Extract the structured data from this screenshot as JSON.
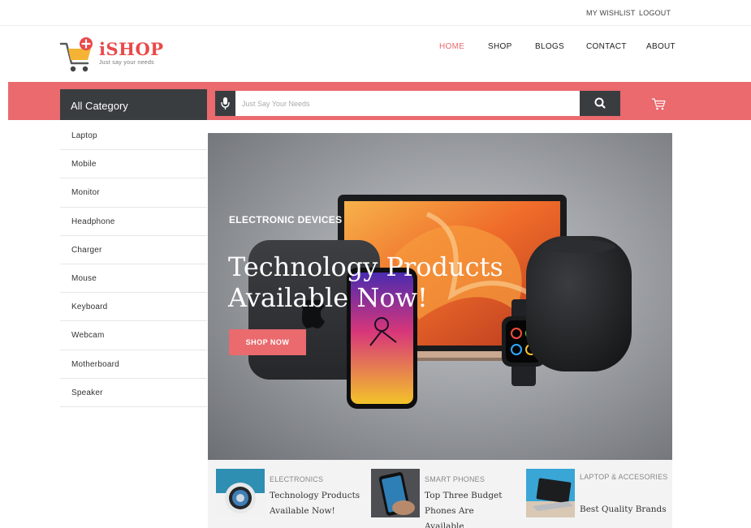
{
  "topbar": {
    "wishlist": "MY WISHLIST",
    "logout": "LOGOUT"
  },
  "brand": {
    "name": "iSHOP",
    "tagline": "Just say your needs"
  },
  "nav": {
    "items": [
      {
        "label": "HOME",
        "active": true
      },
      {
        "label": "SHOP",
        "active": false
      },
      {
        "label": "BLOGS",
        "active": false
      },
      {
        "label": "CONTACT",
        "active": false
      },
      {
        "label": "ABOUT",
        "active": false
      }
    ]
  },
  "search": {
    "category_label": "All Category",
    "placeholder": "Just Say Your Needs",
    "value": ""
  },
  "categories": [
    "Laptop",
    "Mobile",
    "Monitor",
    "Headphone",
    "Charger",
    "Mouse",
    "Keyboard",
    "Webcam",
    "Motherboard",
    "Speaker"
  ],
  "hero": {
    "eyebrow": "ELECTRONIC DEVICES",
    "title_line1": "Technology Products",
    "title_line2": "Available Now!",
    "cta": "SHOP NOW"
  },
  "features": [
    {
      "category": "ELECTRONICS",
      "title": "Technology Products Available Now!"
    },
    {
      "category": "SMART PHONES",
      "title": "Top Three Budget Phones Are Available"
    },
    {
      "category": "LAPTOP & ACCESORIES",
      "title": "Best Quality Brands"
    }
  ],
  "colors": {
    "accent": "#ea6a6e",
    "dark": "#3a3d40",
    "nav_active": "#e96a6a"
  },
  "icons": [
    "shopping-cart-logo-icon",
    "microphone-icon",
    "search-icon",
    "cart-icon"
  ]
}
